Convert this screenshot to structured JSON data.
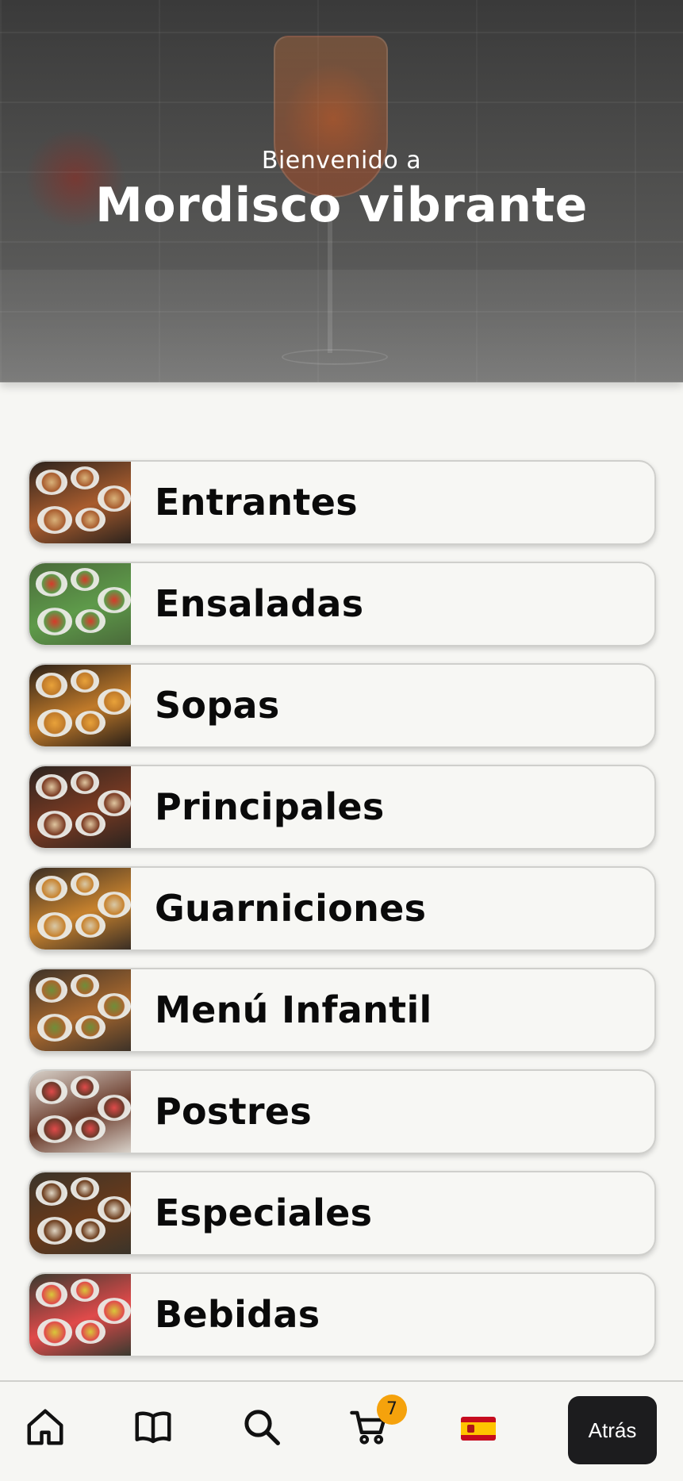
{
  "hero": {
    "subtitle": "Bienvenido a",
    "title": "Mordisco vibrante"
  },
  "categories": [
    {
      "label": "Entrantes",
      "thumb_colors": [
        "#2c231d",
        "#a85c2e",
        "#d9b27a"
      ]
    },
    {
      "label": "Ensaladas",
      "thumb_colors": [
        "#4a6a3a",
        "#5e9a4a",
        "#d83a2a"
      ]
    },
    {
      "label": "Sopas",
      "thumb_colors": [
        "#2a2018",
        "#c07a2a",
        "#e8a23a"
      ]
    },
    {
      "label": "Principales",
      "thumb_colors": [
        "#2b2420",
        "#7a3a22",
        "#e0c6a0"
      ]
    },
    {
      "label": "Guarniciones",
      "thumb_colors": [
        "#3a2e24",
        "#c7822e",
        "#d8c9a8"
      ]
    },
    {
      "label": "Menú Infantil",
      "thumb_colors": [
        "#3d3228",
        "#a8682e",
        "#6e8e3a"
      ]
    },
    {
      "label": "Postres",
      "thumb_colors": [
        "#d8d2ca",
        "#6a3a2a",
        "#e04a4a"
      ]
    },
    {
      "label": "Especiales",
      "thumb_colors": [
        "#3a342a",
        "#6a3a1a",
        "#e0d6c4"
      ]
    },
    {
      "label": "Bebidas",
      "thumb_colors": [
        "#3a3a30",
        "#e04a4a",
        "#d8c83a"
      ]
    }
  ],
  "bottom_nav": {
    "items": [
      "home-icon",
      "menu-book-icon",
      "search-icon",
      "cart-icon",
      "spain-flag-icon"
    ],
    "cart_count": "7",
    "back_label": "Atrás",
    "accent_color": "#f5a20c"
  }
}
